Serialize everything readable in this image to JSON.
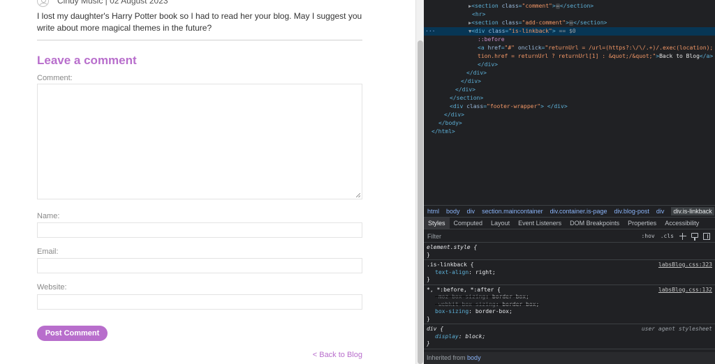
{
  "page": {
    "author_line": "Cindy Music | 02 August 2023",
    "comment_text": "I lost my daughter's Harry Potter book so I had to read her your blog. May I suggest you write about more magical themes in the future?",
    "leave_comment_title": "Leave a comment",
    "labels": {
      "comment": "Comment:",
      "name": "Name:",
      "email": "Email:",
      "website": "Website:"
    },
    "post_button": "Post Comment",
    "back_link": "< Back to Blog",
    "accent_color": "#b86ecc"
  },
  "devtools": {
    "dom_lines": {
      "l0_tag_open": "<section ",
      "l0_attr": "class",
      "l0_val": "\"comment\"",
      "l0_close": "</section>",
      "l1": "<hr>",
      "l2_tag_open": "<section ",
      "l2_attr": "class",
      "l2_val": "\"add-comment\"",
      "l2_close": "</section>",
      "l3_tag_open": "<div ",
      "l3_attr": "class",
      "l3_val": "\"is-linkback\"",
      "l3_tag_end": ">",
      "l3_sel": "== $0",
      "l4": "::before",
      "l5_tag": "<a ",
      "l5_href_attr": "href",
      "l5_href_val": "\"#\"",
      "l5_onclick_attr": "onclick",
      "l5_onclick_val": "\"returnUrl = /url=(https?:\\/\\/.+)/.exec(location); loca",
      "l6_val": "tion.href = returnUrl ? returnUrl[1] : &quot;/&quot;\"",
      "l6_text": "Back to Blog",
      "l6_close": "</a>",
      "l7": "</div>",
      "l8": "</div>",
      "l9": "</div>",
      "l10": "</div>",
      "l11": "</section>",
      "l12_tag": "<div ",
      "l12_attr": "class",
      "l12_val": "\"footer-wrapper\"",
      "l12_close": "</div>",
      "l13": "</div>",
      "l14": "</body>",
      "l15": "</html>"
    },
    "breadcrumbs": [
      "html",
      "body",
      "div",
      "section.maincontainer",
      "div.container.is-page",
      "div.blog-post",
      "div",
      "div.is-linkback"
    ],
    "tabs": [
      "Styles",
      "Computed",
      "Layout",
      "Event Listeners",
      "DOM Breakpoints",
      "Properties",
      "Accessibility"
    ],
    "filter_placeholder": "Filter",
    "filter_hov": ":hov",
    "filter_cls": ".cls",
    "rules": {
      "r0_selector": "element.style {",
      "r1_selector": ".is-linkback {",
      "r1_source": "labsBlog.css:323",
      "r1_prop": "text-align",
      "r1_val": "right;",
      "r2_selector": "*, *:before, *:after {",
      "r2_source": "labsBlog.css:132",
      "r2_p1": "-moz-box-sizing",
      "r2_v1": "border-box;",
      "r2_p2": "-webkit-box-sizing",
      "r2_v2": "border-box;",
      "r2_p3": "box-sizing",
      "r2_v3": "border-box;",
      "r3_selector": "div {",
      "r3_source": "user agent stylesheet",
      "r3_prop": "display",
      "r3_val": "block;",
      "close_brace": "}"
    },
    "inherited_label": "Inherited from",
    "inherited_from": "body",
    "colors": {
      "background": "#202124",
      "selected_row": "#073655",
      "tag": "#5db0d7",
      "attr_value": "#f29766"
    }
  }
}
